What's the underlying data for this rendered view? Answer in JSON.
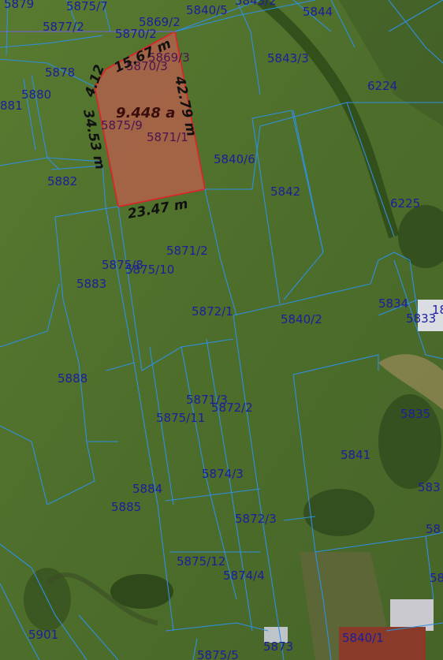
{
  "parcels": [
    {
      "label": "5879"
    },
    {
      "label": "5875/7"
    },
    {
      "label": "5840/5"
    },
    {
      "label": "5843/2"
    },
    {
      "label": "5844"
    },
    {
      "label": "5877/2"
    },
    {
      "label": "5870/2"
    },
    {
      "label": "5869/2"
    },
    {
      "label": "5869/3"
    },
    {
      "label": "5870/3"
    },
    {
      "label": "5843/3"
    },
    {
      "label": "5878"
    },
    {
      "label": "6224"
    },
    {
      "label": "5880"
    },
    {
      "label": "881"
    },
    {
      "label": "5875/9"
    },
    {
      "label": "5871/1"
    },
    {
      "label": "5840/6"
    },
    {
      "label": "5882"
    },
    {
      "label": "5842"
    },
    {
      "label": "6225"
    },
    {
      "label": "5871/2"
    },
    {
      "label": "5875/8"
    },
    {
      "label": "5875/10"
    },
    {
      "label": "5883"
    },
    {
      "label": "5872/1"
    },
    {
      "label": "5840/2"
    },
    {
      "label": "5834"
    },
    {
      "label": "5833"
    },
    {
      "label": "5888"
    },
    {
      "label": "5871/3"
    },
    {
      "label": "5872/2"
    },
    {
      "label": "5875/11"
    },
    {
      "label": "5835"
    },
    {
      "label": "5841"
    },
    {
      "label": "5884"
    },
    {
      "label": "5874/3"
    },
    {
      "label": "5885"
    },
    {
      "label": "5872/3"
    },
    {
      "label": "583"
    },
    {
      "label": "58"
    },
    {
      "label": "5875/12"
    },
    {
      "label": "5874/4"
    },
    {
      "label": "58"
    },
    {
      "label": "5901"
    },
    {
      "label": "5840/1"
    },
    {
      "label": "5873"
    },
    {
      "label": "5875/5"
    },
    {
      "label": "18"
    }
  ],
  "measurements": {
    "left_edge": "34.53 m",
    "right_edge": "42.79 m",
    "bottom_edge": "23.47 m",
    "top_edge_a": "4.12",
    "top_edge_b": "15.67 m",
    "area": "9.448 a"
  },
  "colors": {
    "parcel_line": "#2f8fe0",
    "parcel_label": "#1d1d9c",
    "selected_fill": "#b0624a",
    "selected_stroke": "#e0202a"
  }
}
